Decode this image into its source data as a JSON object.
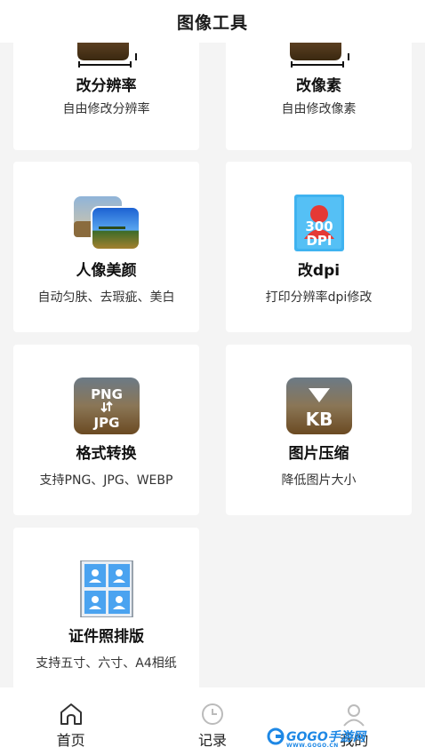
{
  "header": {
    "title": "图像工具"
  },
  "tools": [
    {
      "id": "resolution",
      "title": "改分辨率",
      "desc": "自由修改分辨率",
      "icon": "photo-resize-icon"
    },
    {
      "id": "pixels",
      "title": "改像素",
      "desc": "自由修改像素",
      "icon": "photo-resize-icon"
    },
    {
      "id": "beauty",
      "title": "人像美颜",
      "desc": "自动匀肤、去瑕疵、美白",
      "icon": "photo-stack-icon"
    },
    {
      "id": "dpi",
      "title": "改dpi",
      "desc": "打印分辨率dpi修改",
      "icon": "dpi-icon",
      "icon_text": "300\nDPI"
    },
    {
      "id": "format",
      "title": "格式转换",
      "desc": "支持PNG、JPG、WEBP",
      "icon": "format-convert-icon",
      "icon_top": "PNG",
      "icon_bottom": "JPG"
    },
    {
      "id": "compress",
      "title": "图片压缩",
      "desc": "降低图片大小",
      "icon": "compress-icon",
      "icon_text": "KB"
    },
    {
      "id": "idphoto",
      "title": "证件照排版",
      "desc": "支持五寸、六寸、A4相纸",
      "icon": "id-photo-grid-icon"
    }
  ],
  "tabbar": {
    "items": [
      {
        "label": "首页",
        "icon": "home-icon",
        "active": true
      },
      {
        "label": "记录",
        "icon": "clock-icon",
        "active": false
      },
      {
        "label": "我的",
        "icon": "user-icon",
        "active": false
      }
    ]
  },
  "watermark": {
    "text": "GOGO手游网",
    "sub": "WWW.GOGO.CN"
  },
  "colors": {
    "blue": "#2196f3",
    "sky": "#4a90d9",
    "header_bg": "#ffffff",
    "page_bg": "#f4f4f4"
  }
}
